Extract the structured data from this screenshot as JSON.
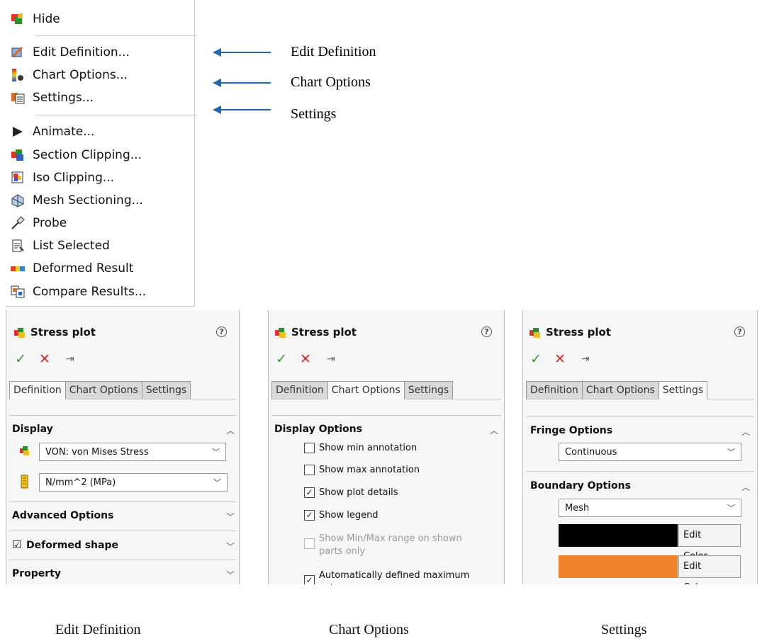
{
  "menu": {
    "items": [
      {
        "label": "Hide",
        "icon": "hide-icon"
      },
      {
        "label": "Edit Definition...",
        "icon": "edit-definition-icon"
      },
      {
        "label": "Chart Options...",
        "icon": "chart-options-icon"
      },
      {
        "label": "Settings...",
        "icon": "settings-icon"
      },
      {
        "label": "Animate...",
        "icon": "play-icon"
      },
      {
        "label": "Section Clipping...",
        "icon": "section-clipping-icon"
      },
      {
        "label": "Iso Clipping...",
        "icon": "iso-clipping-icon"
      },
      {
        "label": "Mesh Sectioning...",
        "icon": "mesh-sectioning-icon"
      },
      {
        "label": "Probe",
        "icon": "probe-icon"
      },
      {
        "label": "List Selected",
        "icon": "list-selected-icon"
      },
      {
        "label": "Deformed Result",
        "icon": "deformed-result-icon"
      },
      {
        "label": "Compare Results...",
        "icon": "compare-results-icon"
      }
    ]
  },
  "annotations": [
    "Edit Definition",
    "Chart Options",
    "Settings"
  ],
  "panel_common": {
    "title": "Stress plot",
    "help": "?",
    "ok": "✓",
    "cancel": "✕",
    "pin": "⇥",
    "tabs": [
      "Definition",
      "Chart Options",
      "Settings"
    ]
  },
  "definition_panel": {
    "display_header": "Display",
    "component_value": "VON: von Mises Stress",
    "units_value": "N/mm^2 (MPa)",
    "advanced_header": "Advanced Options",
    "deformed_header": "Deformed shape",
    "deformed_checked": "☑",
    "property_header": "Property"
  },
  "chart_panel": {
    "header": "Display Options",
    "options": [
      {
        "label": "Show min annotation",
        "mark": ""
      },
      {
        "label": "Show max annotation",
        "mark": ""
      },
      {
        "label": "Show plot details",
        "mark": "✓"
      },
      {
        "label": "Show legend",
        "mark": "✓"
      },
      {
        "label": "Show Min/Max range on shown parts only",
        "mark": ""
      },
      {
        "label": "Automatically defined maximum value",
        "mark": "✓"
      }
    ]
  },
  "settings_panel": {
    "fringe_header": "Fringe Options",
    "fringe_value": "Continuous",
    "boundary_header": "Boundary Options",
    "boundary_value": "Mesh",
    "edit_color_label": "Edit Color...",
    "color1": "#000000",
    "color2": "#f0822c"
  },
  "captions": [
    "Edit Definition",
    "Chart Options",
    "Settings"
  ],
  "colors": {
    "accent_arrow": "#1f67b1",
    "ok": "#2f9e2f",
    "cancel": "#d52a2a"
  }
}
